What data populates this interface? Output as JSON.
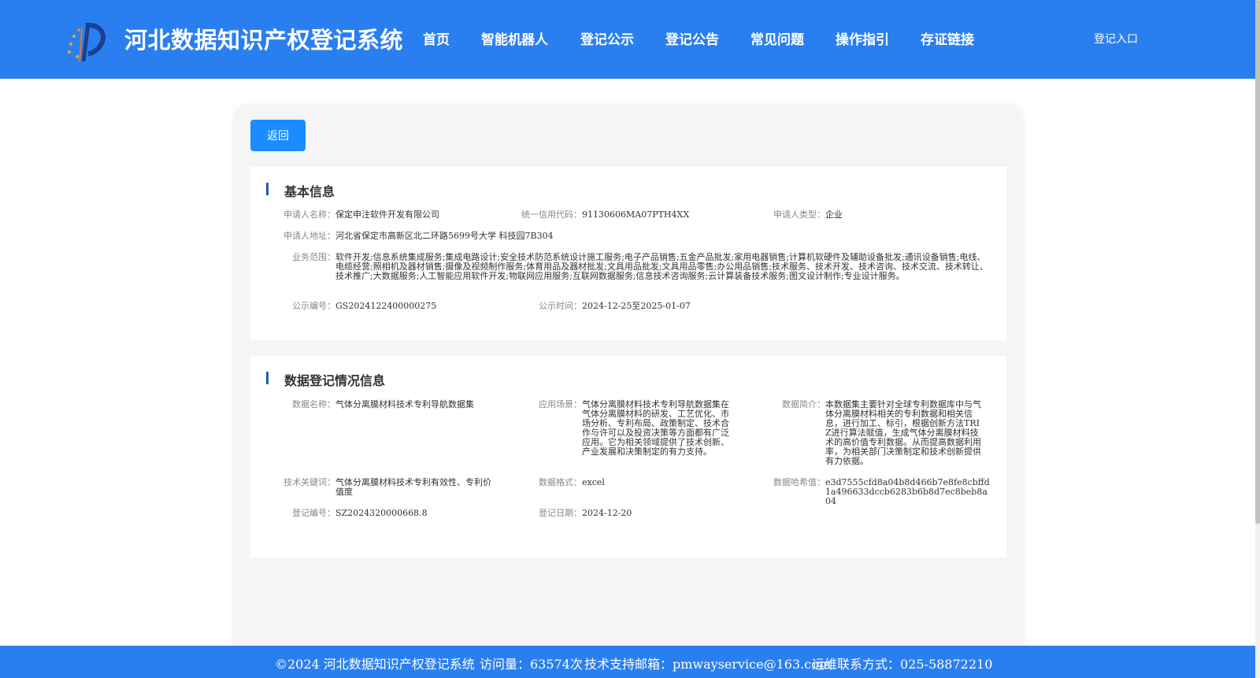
{
  "header": {
    "title": "河北数据知识产权登记系统",
    "nav": [
      "首页",
      "智能机器人",
      "登记公示",
      "登记公告",
      "常见问题",
      "操作指引",
      "存证链接"
    ],
    "login": "登记入口"
  },
  "back_label": "返回",
  "basic": {
    "title": "基本信息",
    "applicant_name_label": "申请人名称：",
    "applicant_name": "保定申注软件开发有限公司",
    "credit_code_label": "统一信用代码：",
    "credit_code": "91130606MA07PTH4XX",
    "applicant_type_label": "申请人类型：",
    "applicant_type": "企业",
    "address_label": "申请人地址：",
    "address": "河北省保定市高新区北二环路5699号大学 科技园7B304",
    "scope_label": "业务范围：",
    "scope": "软件开发;信息系统集成服务;集成电路设计;安全技术防范系统设计施工服务;电子产品销售;五金产品批发;家用电器销售;计算机软硬件及辅助设备批发;通讯设备销售;电线、电缆经营;照相机及器材销售;摄像及视频制作服务;体育用品及器材批发;文具用品批发;文具用品零售;办公用品销售;技术服务、技术开发、技术咨询、技术交流、技术转让、技术推广;大数据服务;人工智能应用软件开发;物联网应用服务;互联网数据服务;信息技术咨询服务;云计算装备技术服务;图文设计制作;专业设计服务。",
    "notice_no_label": "公示编号：",
    "notice_no": "GS2024122400000275",
    "notice_time_label": "公示时间：",
    "notice_time": "2024-12-25至2025-01-07"
  },
  "data_reg": {
    "title": "数据登记情况信息",
    "data_name_label": "数据名称：",
    "data_name": "气体分离膜材料技术专利导航数据集",
    "scenario_label": "应用场景：",
    "scenario": "气体分离膜材料技术专利导航数据集在气体分离膜材料的研发、工艺优化、市场分析、专利布局、政策制定、技术合作与许可以及投资决策等方面都有广泛应用。它为相关领域提供了技术创新、产业发展和决策制定的有力支持。",
    "intro_label": "数据简介：",
    "intro": "本数据集主要针对全球专利数据库中与气体分离膜材料相关的专利数据和相关信息，进行加工、标引，根据创新方法TRIZ进行算法赋值，生成气体分离膜材料技术的高价值专利数据。从而提高数据利用率，为相关部门决策制定和技术创新提供有力依据。",
    "keywords_label": "技术关键词：",
    "keywords": "气体分离膜材料技术专利有效性、专利价值度",
    "format_label": "数据格式：",
    "format": "excel",
    "hash_label": "数据哈希值：",
    "hash": "e3d7555cfd8a04b8d466b7e8fe8cbffd1a496633dccb6283b6b8d7ec8beb8a04",
    "reg_no_label": "登记编号：",
    "reg_no": "SZ2024320000668.8",
    "reg_date_label": "登记日期：",
    "reg_date": "2024-12-20"
  },
  "footer": {
    "copyright": "©2024 河北数据知识产权登记系统",
    "visits": "访问量：63574次",
    "email": "技术支持邮箱：pmwayservice@163.com",
    "phone": "运维联系方式：025-58872210"
  },
  "colors": {
    "header_bg": "#2a7ff0",
    "button_bg": "#1a8cff",
    "title_bar": "#1f5cb8"
  }
}
